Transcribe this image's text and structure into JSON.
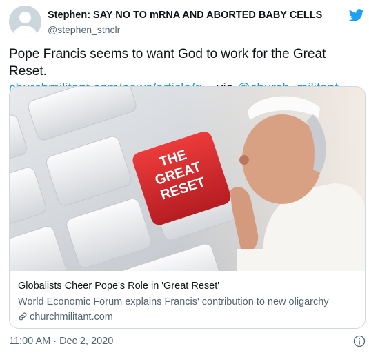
{
  "author": {
    "display_name": "Stephen: SAY NO TO mRNA AND ABORTED BABY CELLS",
    "handle": "@stephen_stnclr"
  },
  "tweet": {
    "text": "Pope Francis seems to want God to work for the Great Reset.",
    "link": "churchmilitant.com/news/article/g...",
    "via": "via",
    "mention": "@church_militant"
  },
  "card": {
    "image_key_text": [
      "THE",
      "GREAT",
      "RESET"
    ],
    "title": "Globalists Cheer Pope's Role in 'Great Reset'",
    "description": "World Economic Forum explains Francis' contribution to new oligarchy",
    "domain": "churchmilitant.com"
  },
  "footer": {
    "timestamp": "11:00 AM · Dec 2, 2020"
  },
  "colors": {
    "link": "#1b95e0",
    "twitter_blue": "#1da1f2",
    "key_red": "#d7262a",
    "secondary_text": "#536471"
  },
  "icons": [
    "twitter-bird-icon",
    "link-icon",
    "info-icon",
    "default-avatar-icon"
  ]
}
